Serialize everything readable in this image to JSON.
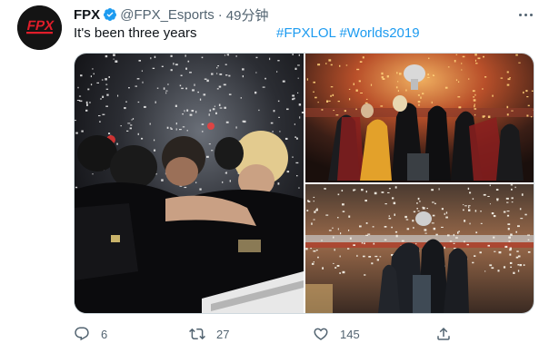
{
  "tweet": {
    "author_name": "FPX",
    "handle": "@FPX_Esports",
    "separator": "·",
    "time": "49分钟",
    "text": "It's been three years",
    "hashtags": [
      "#FPXLOL",
      "#Worlds2019"
    ],
    "avatar_logo": "FPX",
    "verified_icon": "verified-badge-icon",
    "more_icon": "more-options-icon"
  },
  "media": [
    {
      "name": "team-celebration-hug-photo"
    },
    {
      "name": "trophy-lift-stage-photo"
    },
    {
      "name": "trophy-confetti-wide-photo"
    }
  ],
  "actions": {
    "reply": {
      "icon": "reply-icon",
      "count": "6"
    },
    "retweet": {
      "icon": "retweet-icon",
      "count": "27"
    },
    "like": {
      "icon": "like-icon",
      "count": "145"
    },
    "share": {
      "icon": "share-icon"
    }
  },
  "colors": {
    "accent": "#1d9bf0",
    "text": "#0f1419",
    "secondary": "#536471",
    "border": "#cfd9de",
    "logo_red": "#e11d2a"
  }
}
